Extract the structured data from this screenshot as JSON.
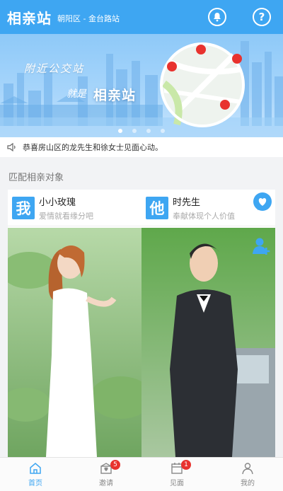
{
  "header": {
    "title": "相亲站",
    "location": "朝阳区 - 金台路站",
    "help_glyph": "?"
  },
  "banner": {
    "line1": "附近公交站",
    "line2": "就是",
    "brand": "相亲站"
  },
  "notice": {
    "text": "恭喜房山区的龙先生和徐女士见面心动。"
  },
  "section": {
    "title": "匹配相亲对象"
  },
  "cards": [
    {
      "badge": "我",
      "name": "小小玫瑰",
      "motto": "爱情就看缘分吧"
    },
    {
      "badge": "他",
      "name": "时先生",
      "motto": "奉献体现个人价值"
    }
  ],
  "tabs": [
    {
      "label": "首页",
      "icon": "home-icon",
      "badge": ""
    },
    {
      "label": "邀请",
      "icon": "invite-icon",
      "badge": "5"
    },
    {
      "label": "见面",
      "icon": "calendar-icon",
      "badge": "1"
    },
    {
      "label": "我的",
      "icon": "person-icon",
      "badge": ""
    }
  ],
  "colors": {
    "accent": "#3ea6f2",
    "badge_red": "#e8322e"
  }
}
